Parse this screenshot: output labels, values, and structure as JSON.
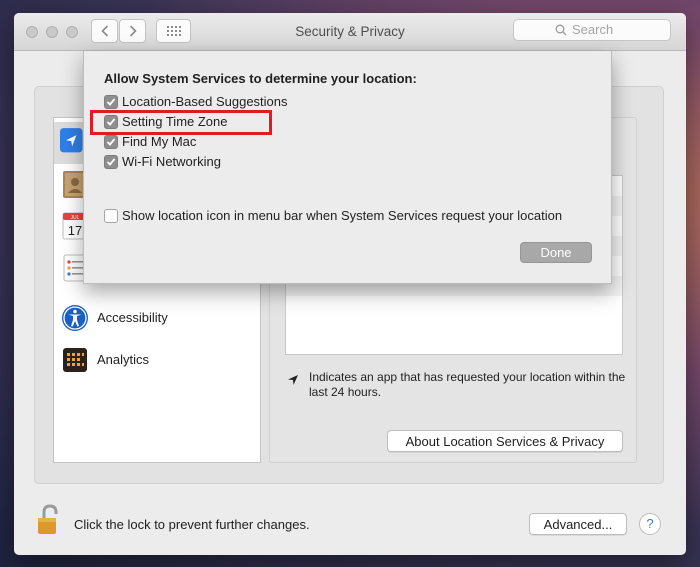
{
  "window": {
    "title": "Security & Privacy"
  },
  "search": {
    "placeholder": "Search"
  },
  "sidebar": {
    "items": [
      {
        "label": "",
        "icon": "location-arrow-icon",
        "selected": true
      },
      {
        "label": "",
        "icon": "contacts-icon"
      },
      {
        "label": "",
        "icon": "calendar-icon"
      },
      {
        "label": "",
        "icon": "reminders-icon"
      },
      {
        "label": "Accessibility",
        "icon": "accessibility-icon"
      },
      {
        "label": "Analytics",
        "icon": "analytics-icon"
      }
    ],
    "calendar_day": "17",
    "calendar_month": "JUL"
  },
  "right": {
    "hint": "Indicates an app that has requested your location within the last 24 hours.",
    "about_button": "About Location Services & Privacy"
  },
  "footer": {
    "lock_text": "Click the lock to prevent further changes.",
    "advanced_button": "Advanced...",
    "help": "?"
  },
  "sheet": {
    "title": "Allow System Services to determine your location:",
    "options": [
      {
        "label": "Location-Based Suggestions",
        "checked": true
      },
      {
        "label": "Setting Time Zone",
        "checked": true
      },
      {
        "label": "Find My Mac",
        "checked": true
      },
      {
        "label": "Wi-Fi Networking",
        "checked": true
      }
    ],
    "menu_bar_option": {
      "label": "Show location icon in menu bar when System Services request your location",
      "checked": false
    },
    "done_button": "Done"
  },
  "colors": {
    "highlight": "#e01b24",
    "accent": "#3a7ae0"
  }
}
